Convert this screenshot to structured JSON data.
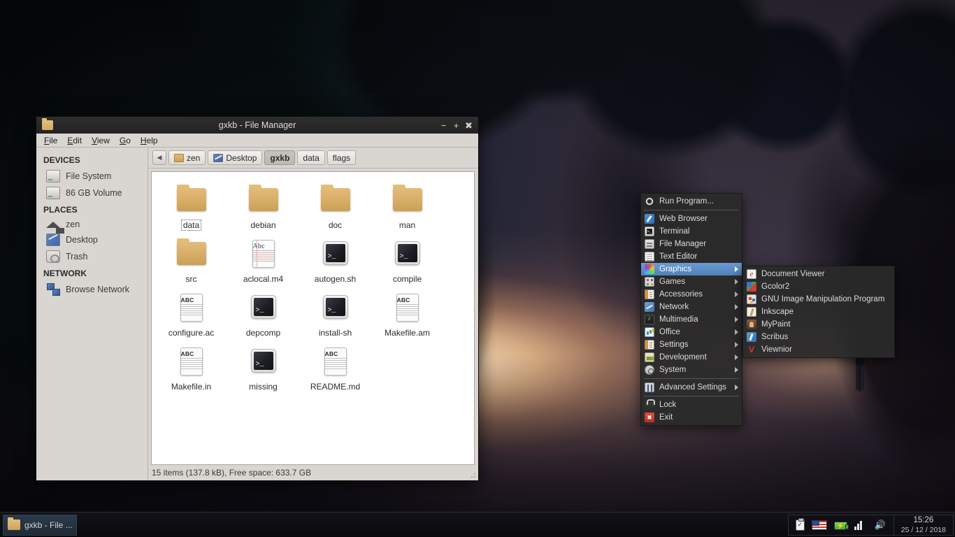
{
  "window": {
    "title": "gxkb - File Manager",
    "titlebar_icon": "folder-icon",
    "buttons": {
      "minimize": "−",
      "maximize": "+",
      "close": "✖"
    },
    "menubar": [
      {
        "label": "File",
        "accel": "F"
      },
      {
        "label": "Edit",
        "accel": "E"
      },
      {
        "label": "View",
        "accel": "V"
      },
      {
        "label": "Go",
        "accel": "G"
      },
      {
        "label": "Help",
        "accel": "H"
      }
    ]
  },
  "sidebar": {
    "groups": [
      {
        "title": "DEVICES",
        "items": [
          {
            "label": "File System",
            "icon": "drive-icon"
          },
          {
            "label": "86 GB Volume",
            "icon": "drive-icon"
          }
        ]
      },
      {
        "title": "PLACES",
        "items": [
          {
            "label": "zen",
            "icon": "home-icon"
          },
          {
            "label": "Desktop",
            "icon": "desktop-icon"
          },
          {
            "label": "Trash",
            "icon": "trash-icon"
          }
        ]
      },
      {
        "title": "NETWORK",
        "items": [
          {
            "label": "Browse Network",
            "icon": "network-icon"
          }
        ]
      }
    ]
  },
  "pathbar": {
    "back_arrow": "◀",
    "crumbs": [
      {
        "label": "zen",
        "icon": "home-folder-icon",
        "active": false
      },
      {
        "label": "Desktop",
        "icon": "desktop-icon",
        "active": false
      },
      {
        "label": "gxkb",
        "icon": "none",
        "active": true
      },
      {
        "label": "data",
        "icon": "none",
        "active": false
      },
      {
        "label": "flags",
        "icon": "none",
        "active": false
      }
    ]
  },
  "files": [
    {
      "name": "data",
      "type": "folder",
      "focused": true
    },
    {
      "name": "debian",
      "type": "folder",
      "focused": false
    },
    {
      "name": "doc",
      "type": "folder",
      "focused": false
    },
    {
      "name": "man",
      "type": "folder",
      "focused": false
    },
    {
      "name": "src",
      "type": "folder",
      "focused": false
    },
    {
      "name": "aclocal.m4",
      "type": "document-ruled",
      "focused": false
    },
    {
      "name": "autogen.sh",
      "type": "script",
      "focused": false
    },
    {
      "name": "compile",
      "type": "script",
      "focused": false
    },
    {
      "name": "configure.ac",
      "type": "document-plain",
      "focused": false
    },
    {
      "name": "depcomp",
      "type": "script",
      "focused": false
    },
    {
      "name": "install-sh",
      "type": "script",
      "focused": false
    },
    {
      "name": "Makefile.am",
      "type": "document-plain",
      "focused": false
    },
    {
      "name": "Makefile.in",
      "type": "document-plain",
      "focused": false
    },
    {
      "name": "missing",
      "type": "script",
      "focused": false
    },
    {
      "name": "README.md",
      "type": "document-plain",
      "focused": false
    }
  ],
  "doc_badges": {
    "ruled": "Abc",
    "plain": "ABC"
  },
  "statusbar": {
    "text": "15 items (137.8 kB), Free space: 633.7 GB"
  },
  "root_menu": {
    "items": [
      {
        "label": "Run Program...",
        "icon": "gear-icon",
        "submenu": false,
        "highlighted": false,
        "separator_after": true
      },
      {
        "label": "Web Browser",
        "icon": "web-browser-icon",
        "submenu": false,
        "highlighted": false
      },
      {
        "label": "Terminal",
        "icon": "terminal-icon",
        "submenu": false,
        "highlighted": false
      },
      {
        "label": "File Manager",
        "icon": "file-manager-icon",
        "submenu": false,
        "highlighted": false
      },
      {
        "label": "Text Editor",
        "icon": "text-editor-icon",
        "submenu": false,
        "highlighted": false
      },
      {
        "label": "Graphics",
        "icon": "graphics-icon",
        "submenu": true,
        "highlighted": true
      },
      {
        "label": "Games",
        "icon": "games-icon",
        "submenu": true,
        "highlighted": false
      },
      {
        "label": "Accessories",
        "icon": "accessories-icon",
        "submenu": true,
        "highlighted": false
      },
      {
        "label": "Network",
        "icon": "network-icon",
        "submenu": true,
        "highlighted": false
      },
      {
        "label": "Multimedia",
        "icon": "multimedia-icon",
        "submenu": true,
        "highlighted": false
      },
      {
        "label": "Office",
        "icon": "office-icon",
        "submenu": true,
        "highlighted": false
      },
      {
        "label": "Settings",
        "icon": "settings-icon",
        "submenu": true,
        "highlighted": false
      },
      {
        "label": "Development",
        "icon": "development-icon",
        "submenu": true,
        "highlighted": false
      },
      {
        "label": "System",
        "icon": "system-icon",
        "submenu": true,
        "highlighted": false,
        "separator_after": true
      },
      {
        "label": "Advanced Settings",
        "icon": "advanced-settings-icon",
        "submenu": true,
        "highlighted": false,
        "separator_after": true
      },
      {
        "label": "Lock",
        "icon": "lock-icon",
        "submenu": false,
        "highlighted": false
      },
      {
        "label": "Exit",
        "icon": "exit-icon",
        "submenu": false,
        "highlighted": false
      }
    ]
  },
  "sub_menu": {
    "parent": "Graphics",
    "items": [
      {
        "label": "Document Viewer",
        "icon": "document-viewer-icon"
      },
      {
        "label": "Gcolor2",
        "icon": "gcolor2-icon"
      },
      {
        "label": "GNU Image Manipulation Program",
        "icon": "gimp-icon"
      },
      {
        "label": "Inkscape",
        "icon": "inkscape-icon"
      },
      {
        "label": "MyPaint",
        "icon": "mypaint-icon"
      },
      {
        "label": "Scribus",
        "icon": "scribus-icon"
      },
      {
        "label": "Viewnior",
        "icon": "viewnior-icon"
      }
    ]
  },
  "taskbar": {
    "task_label": "gxkb - File ...",
    "task_icon": "folder-icon",
    "tray": [
      {
        "name": "clipboard-icon"
      },
      {
        "name": "keyboard-layout-flag-icon"
      },
      {
        "name": "battery-icon"
      },
      {
        "name": "signal-strength-icon"
      },
      {
        "name": "volume-icon"
      }
    ],
    "clock": {
      "time": "15:26",
      "date": "25 / 12 / 2018"
    }
  },
  "colors": {
    "menu_highlight": "#5a8ec4",
    "menu_bg": "#2a2a2a",
    "window_chrome": "#d9d6d2",
    "titlebar": "#262626",
    "taskbar": "#0d0d12"
  }
}
